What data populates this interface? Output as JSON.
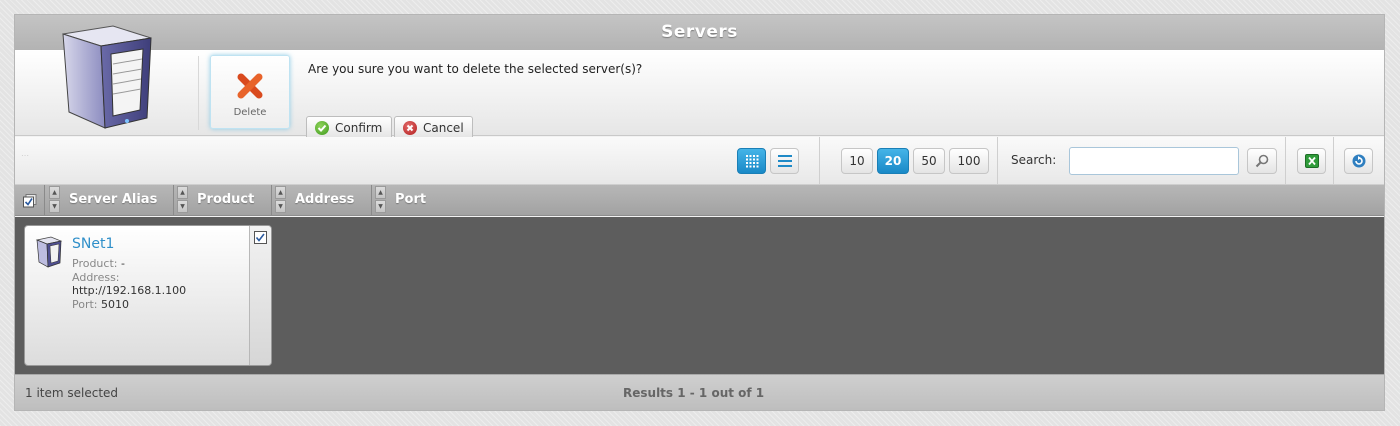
{
  "window": {
    "title": "Servers"
  },
  "header": {
    "delete_label": "Delete",
    "confirm_message": "Are you sure you want to delete the selected server(s)?",
    "confirm_label": "Confirm",
    "cancel_label": "Cancel"
  },
  "toolbar": {
    "page_sizes": [
      "10",
      "20",
      "50",
      "100"
    ],
    "active_page_size": "20",
    "search_label": "Search:",
    "search_value": ""
  },
  "columns": [
    "Server Alias",
    "Product",
    "Address",
    "Port"
  ],
  "servers": [
    {
      "alias": "SNet1",
      "product_label": "Product:",
      "product": "-",
      "address_label": "Address:",
      "address": "http://192.168.1.100",
      "port_label": "Port:",
      "port": "5010",
      "selected": true
    }
  ],
  "status": {
    "selection": "1 item selected",
    "results": "Results 1 - 1 out of 1"
  },
  "colors": {
    "accent": "#1d8fcf",
    "link": "#2f8fc9",
    "content_bg": "#5d5d5d"
  },
  "icons": {
    "logo": "server-tower-icon",
    "delete": "red-x-icon",
    "confirm": "green-check-icon",
    "cancel": "red-x-circle-icon",
    "view_grid": "grid-view-icon",
    "view_list": "list-view-icon",
    "search": "magnifier-icon",
    "export": "excel-icon",
    "refresh": "refresh-icon"
  }
}
